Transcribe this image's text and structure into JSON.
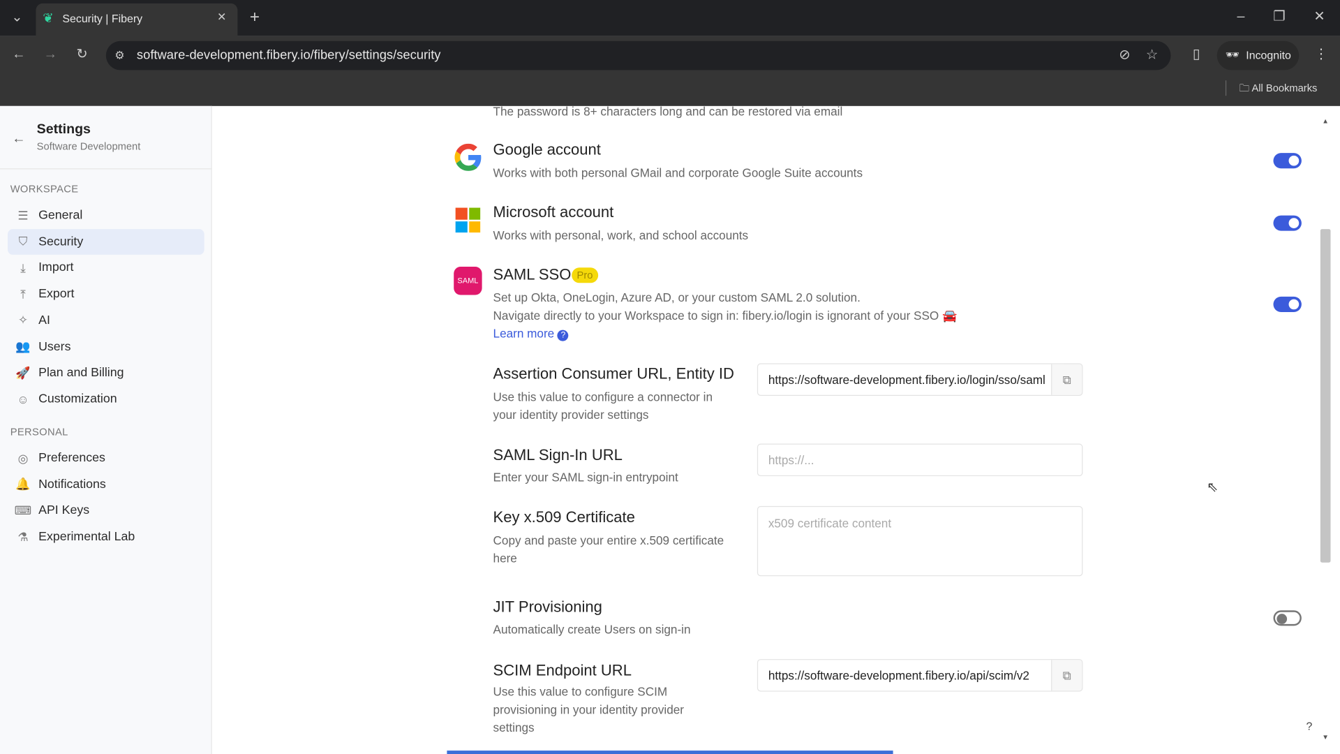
{
  "browser": {
    "tab_title": "Security | Fibery",
    "url": "software-development.fibery.io/fibery/settings/security",
    "incognito_label": "Incognito",
    "bookmarks_label": "All Bookmarks"
  },
  "sidebar": {
    "title": "Settings",
    "subtitle": "Software Development",
    "workspace_label": "WORKSPACE",
    "personal_label": "PERSONAL",
    "workspace_items": [
      {
        "label": "General",
        "icon": "sliders-icon"
      },
      {
        "label": "Security",
        "icon": "shield-icon",
        "active": true
      },
      {
        "label": "Import",
        "icon": "import-icon"
      },
      {
        "label": "Export",
        "icon": "export-icon"
      },
      {
        "label": "AI",
        "icon": "sparkle-icon"
      },
      {
        "label": "Users",
        "icon": "users-icon"
      },
      {
        "label": "Plan and Billing",
        "icon": "rocket-icon"
      },
      {
        "label": "Customization",
        "icon": "smiley-icon"
      }
    ],
    "personal_items": [
      {
        "label": "Preferences",
        "icon": "preferences-icon"
      },
      {
        "label": "Notifications",
        "icon": "bell-icon"
      },
      {
        "label": "API Keys",
        "icon": "terminal-icon"
      },
      {
        "label": "Experimental Lab",
        "icon": "flask-icon"
      }
    ]
  },
  "main": {
    "password_desc": "The password is 8+ characters long and can be restored via email",
    "google": {
      "title": "Google account",
      "desc": "Works with both personal GMail and corporate Google Suite accounts",
      "enabled": true
    },
    "microsoft": {
      "title": "Microsoft account",
      "desc": "Works with personal, work, and school accounts",
      "enabled": true
    },
    "saml": {
      "icon_text": "SAML",
      "title": "SAML SSO",
      "badge": "Pro",
      "desc1": "Set up Okta, OneLogin, Azure AD, or your custom SAML 2.0 solution.",
      "desc2": "Navigate directly to your Workspace to sign in: fibery.io/login is ignorant of your SSO 🚘",
      "learn_more": "Learn more",
      "enabled": true
    },
    "acs": {
      "title": "Assertion Consumer URL, Entity ID",
      "desc": "Use this value to configure a connector in your identity provider settings",
      "value": "https://software-development.fibery.io/login/sso/saml"
    },
    "signin": {
      "title": "SAML Sign-In URL",
      "desc": "Enter your SAML sign-in entrypoint",
      "placeholder": "https://..."
    },
    "cert": {
      "title": "Key x.509 Certificate",
      "desc": "Copy and paste your entire x.509 certificate here",
      "placeholder": "x509 certificate content"
    },
    "jit": {
      "title": "JIT Provisioning",
      "desc": "Automatically create Users on sign-in",
      "enabled": false
    },
    "scim": {
      "title": "SCIM Endpoint URL",
      "desc": "Use this value to configure SCIM provisioning in your identity provider settings",
      "value": "https://software-development.fibery.io/api/scim/v2"
    }
  },
  "help_label": "?",
  "colors": {
    "accent": "#3b5bdb",
    "saml": "#e0186c",
    "pro_badge": "#f5d90a"
  }
}
